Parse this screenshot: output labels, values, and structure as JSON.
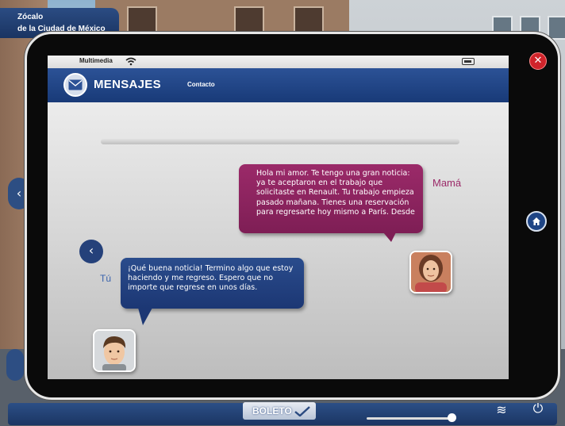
{
  "location": {
    "line1": "Zócalo",
    "line2": "de la Ciudad de México"
  },
  "tablet": {
    "status": {
      "carrier": "Multimedia"
    },
    "header": {
      "title": "MENSAJES",
      "tab": "Contacto"
    },
    "conversation": [
      {
        "speaker": "Mamá",
        "text": "Hola mi amor. Te tengo una gran noticia: ya te aceptaron en el trabajo que solicitaste en Renault. Tu trabajo empieza pasado mañana. Tienes una reservación para regresarte hoy mismo a París. Desde"
      },
      {
        "speaker": "Tú",
        "text": "¡Qué buena noticia! Termino algo que estoy haciendo y me regreso. Espero que no importe que regrese en unos días."
      }
    ]
  },
  "bottom_bar": {
    "ticket_label": "BOLETO"
  },
  "colors": {
    "header": "#183a78",
    "mama_bubble": "#8a2460",
    "tu_bubble": "#213f80",
    "close": "#d0242b"
  }
}
